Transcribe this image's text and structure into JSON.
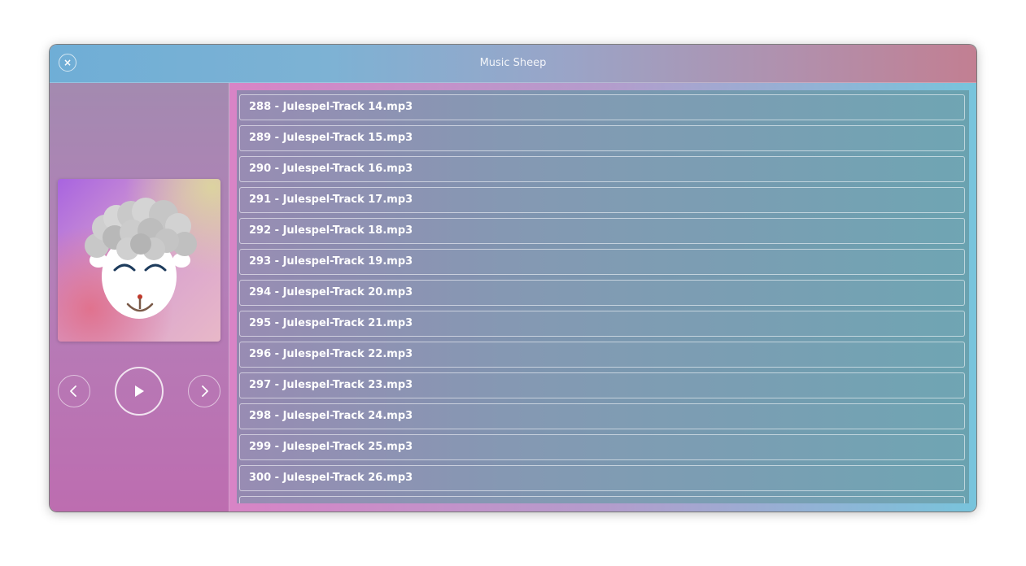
{
  "window": {
    "title": "Music Sheep",
    "close_icon": "×"
  },
  "player": {
    "album_art_icon": "sheep-icon",
    "prev_icon": "chevron-left-icon",
    "play_icon": "play-icon",
    "next_icon": "chevron-right-icon"
  },
  "playlist": {
    "tracks": [
      "288 - Julespel-Track 14.mp3",
      "289 - Julespel-Track 15.mp3",
      "290 - Julespel-Track 16.mp3",
      "291 - Julespel-Track 17.mp3",
      "292 - Julespel-Track 18.mp3",
      "293 - Julespel-Track 19.mp3",
      "294 - Julespel-Track 20.mp3",
      "295 - Julespel-Track 21.mp3",
      "296 - Julespel-Track 22.mp3",
      "297 - Julespel-Track 23.mp3",
      "298 - Julespel-Track 24.mp3",
      "299 - Julespel-Track 25.mp3",
      "300 - Julespel-Track 26.mp3",
      ""
    ]
  },
  "colors": {
    "titlebar_left": "#6faed6",
    "titlebar_right": "#c27f92",
    "sidebar": "#bd6db0",
    "list_text": "#ffffff"
  }
}
